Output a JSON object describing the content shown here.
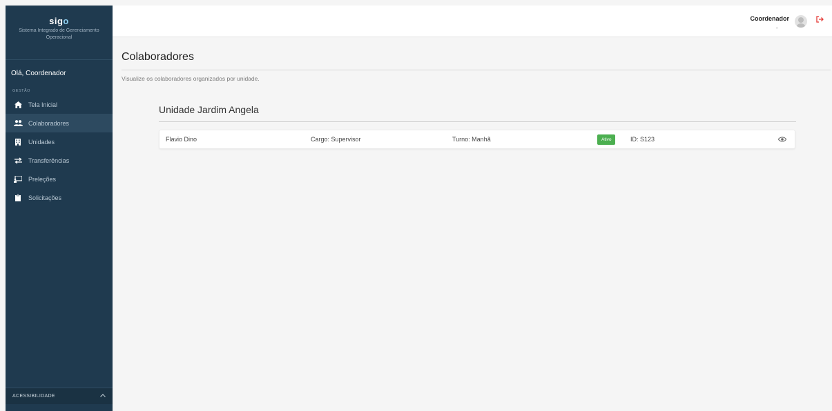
{
  "sidebar": {
    "logo_main": "sig",
    "logo_accent": "o",
    "subtitle": "Sistema Integrado de Gerenciamento Operacional",
    "greeting": "Olá, Coordenador",
    "section_label": "GESTÃO",
    "items": [
      {
        "label": "Tela Inicial",
        "icon": "home-icon",
        "active": false
      },
      {
        "label": "Colaboradores",
        "icon": "people-icon",
        "active": true
      },
      {
        "label": "Unidades",
        "icon": "building-icon",
        "active": false
      },
      {
        "label": "Transferências",
        "icon": "swap-icon",
        "active": false
      },
      {
        "label": "Preleções",
        "icon": "presentation-icon",
        "active": false
      },
      {
        "label": "Solicitações",
        "icon": "clipboard-icon",
        "active": false
      }
    ],
    "accessibility_label": "ACESSIBILIDADE"
  },
  "topbar": {
    "user_name": "Coordenador",
    "user_role": "□"
  },
  "main": {
    "title": "Colaboradores",
    "description": "Visualize os colaboradores organizados por unidade.",
    "units": [
      {
        "name": "Unidade Jardim Angela",
        "rows": [
          {
            "name": "Flavio Dino",
            "cargo": "Cargo: Supervisor",
            "turno": "Turno: Manhã",
            "status": "Ativo",
            "id": "ID: S123"
          }
        ]
      }
    ]
  },
  "colors": {
    "sidebar_bg": "#1f3a4f",
    "sidebar_active": "#2d4a60",
    "badge_active": "#4caf50",
    "logout": "#e53935"
  }
}
